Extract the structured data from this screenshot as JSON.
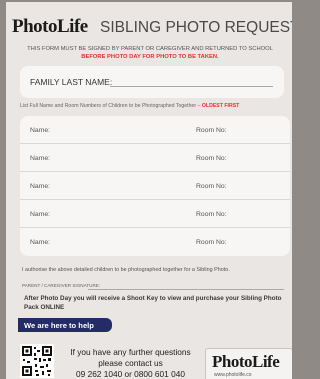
{
  "header": {
    "brand": "PhotoLife",
    "title": "SIBLING PHOTO REQUEST"
  },
  "notice": {
    "line1": "THIS FORM MUST BE SIGNED BY PARENT OR CAREGIVER AND RETURNED TO SCHOOL",
    "line2": "BEFORE PHOTO DAY FOR PHOTO TO BE TAKEN."
  },
  "family": {
    "label": "FAMILY LAST NAME:"
  },
  "instructions": {
    "text": "List Full Name and Room Numbers of Children to be Photographed Together –",
    "highlight": "OLDEST FIRST"
  },
  "children": [
    {
      "name_label": "Name:",
      "room_label": "Room No:"
    },
    {
      "name_label": "Name:",
      "room_label": "Room No:"
    },
    {
      "name_label": "Name:",
      "room_label": "Room No:"
    },
    {
      "name_label": "Name:",
      "room_label": "Room No:"
    },
    {
      "name_label": "Name:",
      "room_label": "Room No:"
    }
  ],
  "authorise": "I authorise the above detailed children to be photographed together for a Sibling Photo.",
  "signature_label": "PARENT / CAREGIVER SIGNATURE:",
  "after_photo": "After Photo Day you will receive a Shoot Key to view and purchase your Sibling Photo Pack ONLINE",
  "help": "We are here to help",
  "contact": {
    "line1": "If you have any further questions",
    "line2": "please contact us",
    "line3": "09 262 1040 or 0800 601 040"
  },
  "logo": {
    "text": "PhotoLife",
    "web": "www.photolife.co"
  },
  "colors": {
    "accent_red": "#e0322a",
    "navy": "#242c67"
  }
}
